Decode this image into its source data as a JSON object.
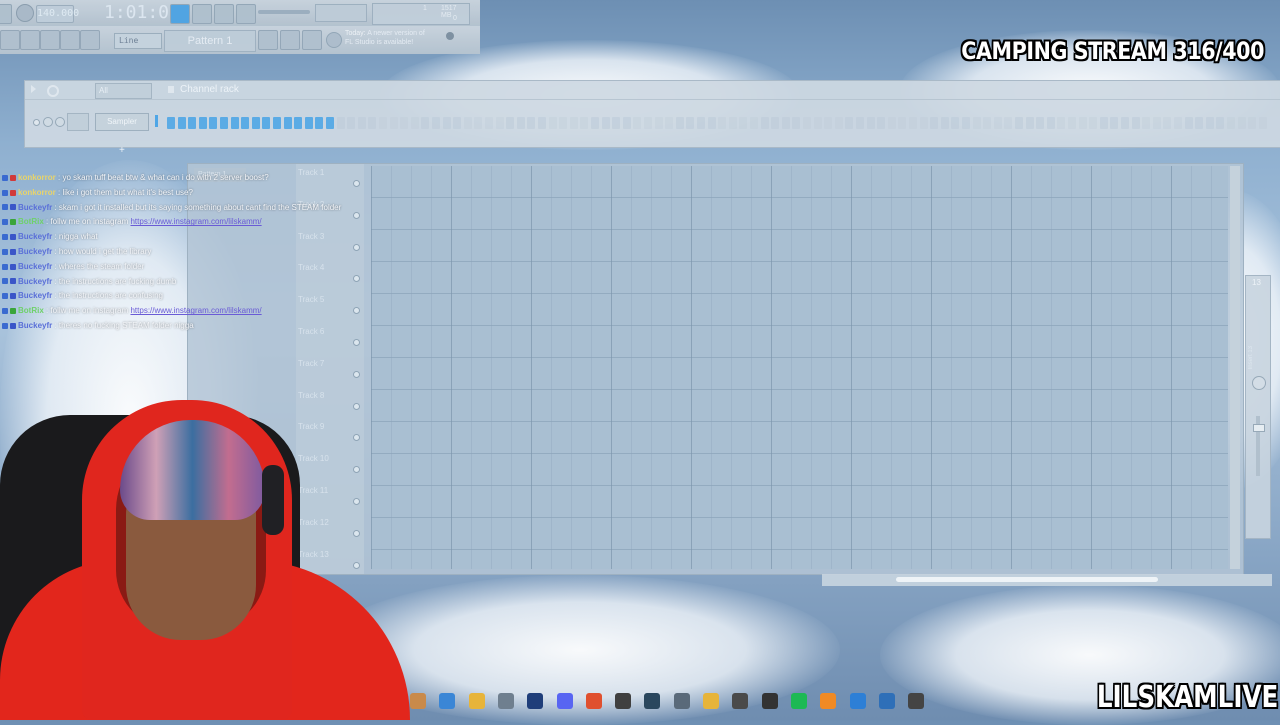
{
  "toolbar": {
    "tempo": "140.000",
    "time": "1:01:00",
    "cpu_value": "1",
    "mem_value": "1517 MB",
    "cpu_value2": "0",
    "snap_mode": "Line",
    "pattern_name": "Pattern 1",
    "hint_title": "Today:",
    "hint_text_1": "A newer version of",
    "hint_text_2": "FL Studio is available!"
  },
  "channel_rack": {
    "filter": "All",
    "title": "Channel rack",
    "channel_name": "Sampler",
    "add_label": "+"
  },
  "playlist": {
    "pattern_tab": "Pattern 1",
    "tracks": [
      "Track 1",
      "Track 2",
      "Track 3",
      "Track 4",
      "Track 5",
      "Track 6",
      "Track 7",
      "Track 8",
      "Track 9",
      "Track 10",
      "Track 11",
      "Track 12",
      "Track 13"
    ]
  },
  "mixer": {
    "number": "13",
    "insert_label": "Insert 13"
  },
  "overlay": {
    "stream_title": "CAMPING STREAM 316/400",
    "brand": "LILSKAMLIVE"
  },
  "chat": [
    {
      "user": "konkorror",
      "color": "#e8d46a",
      "badge": "#d13a3a",
      "msg": ": yo skam tuff beat btw & what can i do with 2 server boost?",
      "link": ""
    },
    {
      "user": "konkorror",
      "color": "#e8d46a",
      "badge": "#d13a3a",
      "msg": ": like i got them but what it's best use?",
      "link": ""
    },
    {
      "user": "Buckeyfr",
      "color": "#5a6fd8",
      "badge": "#3a55c8",
      "msg": ": skam i got it installed but its saying something about cant find the STEAM folder",
      "link": ""
    },
    {
      "user": "BotRix",
      "color": "#6fd16a",
      "badge": "#3aa53a",
      "msg": ": follw me on instagram",
      "link": "https://www.instagram.com/lilskamm/"
    },
    {
      "user": "Buckeyfr",
      "color": "#5a6fd8",
      "badge": "#3a55c8",
      "msg": ": nigga what",
      "link": ""
    },
    {
      "user": "Buckeyfr",
      "color": "#5a6fd8",
      "badge": "#3a55c8",
      "msg": ": how would i get the library",
      "link": ""
    },
    {
      "user": "Buckeyfr",
      "color": "#5a6fd8",
      "badge": "#3a55c8",
      "msg": ": wheres the steam folder",
      "link": ""
    },
    {
      "user": "Buckeyfr",
      "color": "#5a6fd8",
      "badge": "#3a55c8",
      "msg": ": the instructions are fucking dumb",
      "link": ""
    },
    {
      "user": "Buckeyfr",
      "color": "#5a6fd8",
      "badge": "#3a55c8",
      "msg": ": the instructions are confusing",
      "link": ""
    },
    {
      "user": "BotRix",
      "color": "#6fd16a",
      "badge": "#3aa53a",
      "msg": ": follw me on instagram",
      "link": "https://www.instagram.com/lilskamm/"
    },
    {
      "user": "Buckeyfr",
      "color": "#5a6fd8",
      "badge": "#3a55c8",
      "msg": ": theres no fucking STEAM folder nigga",
      "link": ""
    }
  ],
  "taskbar": [
    "ai-icon",
    "chrome-icon",
    "folder-icon",
    "store-icon",
    "photoshop-icon",
    "discord-icon",
    "brave-icon",
    "obs-icon",
    "steam-icon",
    "app-icon",
    "money-icon",
    "4k-icon",
    "capcut-icon",
    "spotify-icon",
    "fl-icon",
    "azure-icon",
    "notepad-icon",
    "media-icon"
  ],
  "colors": {
    "accent_step": "#4fa6e6",
    "step_off": "#bccbd8"
  }
}
